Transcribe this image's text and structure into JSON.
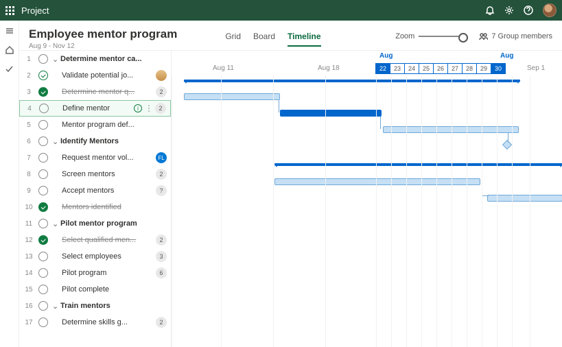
{
  "topbar": {
    "title": "Project"
  },
  "header": {
    "title": "Employee mentor program",
    "date_range": "Aug 9 - Nov 12",
    "views": {
      "grid": "Grid",
      "board": "Board",
      "timeline": "Timeline"
    },
    "zoom_label": "Zoom",
    "members": "7 Group members"
  },
  "timeline_header": {
    "month1": "Aug",
    "month2": "Aug",
    "ticks": {
      "aug11": "Aug 11",
      "aug18": "Aug 18",
      "sep1": "Sep 1"
    },
    "days": [
      "22",
      "23",
      "24",
      "25",
      "26",
      "27",
      "28",
      "29",
      "30"
    ]
  },
  "tasks": [
    {
      "n": "1",
      "label": "Determine mentor ca...",
      "bold": true,
      "group": true
    },
    {
      "n": "2",
      "label": "Validate potential jo...",
      "indent": true,
      "assignee": true,
      "check": true
    },
    {
      "n": "3",
      "label": "Determine mentor q...",
      "indent": true,
      "done": true,
      "struck": true,
      "badge": "2"
    },
    {
      "n": "4",
      "label": "Define mentor",
      "indent": true,
      "selected": true,
      "info": true,
      "kebab": true,
      "badge": "2"
    },
    {
      "n": "5",
      "label": "Mentor program def...",
      "indent": true
    },
    {
      "n": "6",
      "label": "Identify Mentors",
      "bold": true,
      "group": true
    },
    {
      "n": "7",
      "label": "Request mentor vol...",
      "indent": true,
      "badge": "FL",
      "badgeBlue": true
    },
    {
      "n": "8",
      "label": "Screen mentors",
      "indent": true,
      "badge": "2"
    },
    {
      "n": "9",
      "label": "Accept mentors",
      "indent": true,
      "badge": "?"
    },
    {
      "n": "10",
      "label": "Mentors identified",
      "indent": true,
      "done": true,
      "struck": true
    },
    {
      "n": "11",
      "label": "Pilot mentor program",
      "bold": true,
      "group": true
    },
    {
      "n": "12",
      "label": "Select qualified men...",
      "indent": true,
      "done": true,
      "struck": true,
      "badge": "2"
    },
    {
      "n": "13",
      "label": "Select employees",
      "indent": true,
      "badge": "3"
    },
    {
      "n": "14",
      "label": "Pilot program",
      "indent": true,
      "badge": "6"
    },
    {
      "n": "15",
      "label": "Pilot complete",
      "indent": true
    },
    {
      "n": "16",
      "label": "Train mentors",
      "bold": true,
      "group": true
    },
    {
      "n": "17",
      "label": "Determine skills g...",
      "indent": true,
      "badge": "2"
    }
  ]
}
